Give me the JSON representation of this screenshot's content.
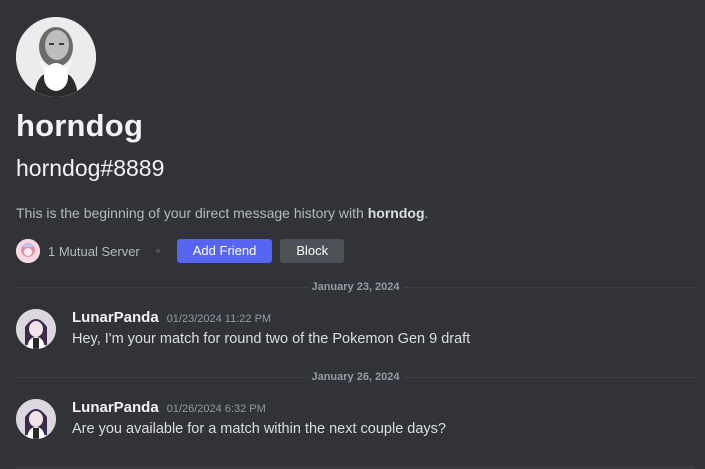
{
  "profile": {
    "display_name": "horndog",
    "tag": "horndog#8889",
    "avatar_icon": "elderly-bearded-man-avatar"
  },
  "intro": {
    "prefix": "This is the beginning of your direct message history with ",
    "name": "horndog",
    "suffix": "."
  },
  "actions": {
    "mutual_servers": "1 Mutual Server",
    "add_friend_label": "Add Friend",
    "block_label": "Block"
  },
  "messages": [
    {
      "date_divider": "January 23, 2024",
      "author": "LunarPanda",
      "timestamp": "01/23/2024 11:22 PM",
      "content": "Hey, I'm your match for round two of the Pokemon Gen 9 draft"
    },
    {
      "date_divider": "January 26, 2024",
      "author": "LunarPanda",
      "timestamp": "01/26/2024 6:32 PM",
      "content": "Are you available for a match within the next couple days?"
    }
  ],
  "colors": {
    "background": "#313338",
    "primary_button": "#5865f2",
    "secondary_button": "#4e5058"
  }
}
